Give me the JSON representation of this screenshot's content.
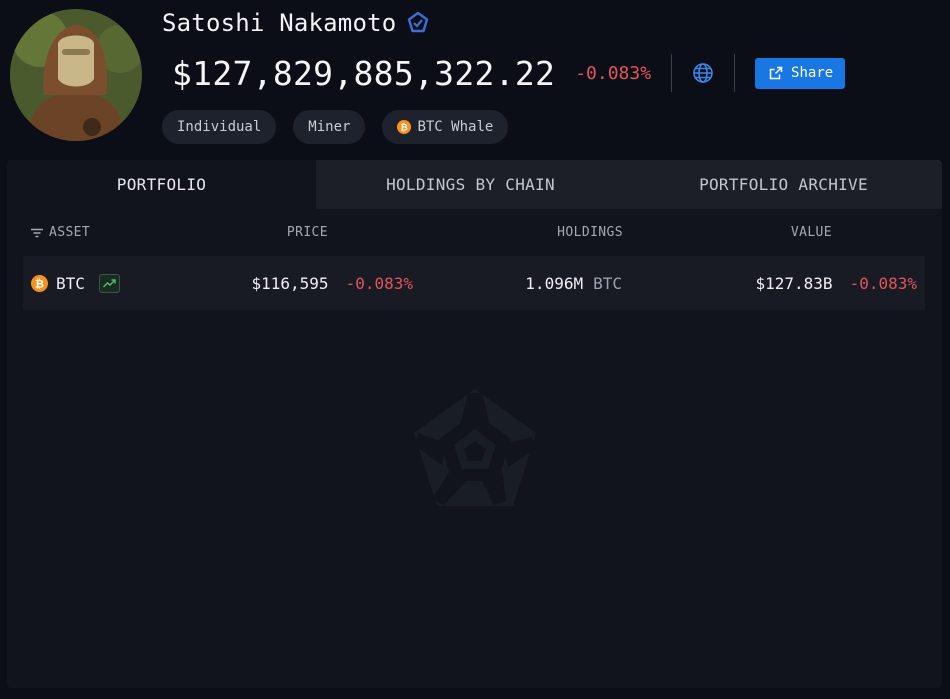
{
  "profile": {
    "name": "Satoshi Nakamoto",
    "verified_icon": "verified-badge-icon",
    "avatar_icon": "avatar-statue-image",
    "total_value": "$127,829,885,322.22",
    "total_change": "-0.083%",
    "share_label": "Share",
    "tags": [
      {
        "label": "Individual"
      },
      {
        "label": "Miner"
      },
      {
        "label": "BTC Whale",
        "icon": "bitcoin-coin-icon"
      }
    ]
  },
  "tabs": [
    {
      "label": "PORTFOLIO",
      "active": true
    },
    {
      "label": "HOLDINGS BY CHAIN",
      "active": false
    },
    {
      "label": "PORTFOLIO ARCHIVE",
      "active": false
    }
  ],
  "table": {
    "headers": {
      "asset": "ASSET",
      "price": "PRICE",
      "holdings": "HOLDINGS",
      "value": "VALUE"
    },
    "rows": [
      {
        "asset": "BTC",
        "price": "$116,595",
        "price_change": "-0.083%",
        "holdings": "1.096M",
        "holdings_unit": "BTC",
        "value": "$127.83B",
        "value_change": "-0.083%"
      }
    ]
  },
  "colors": {
    "background": "#0b0e16",
    "panel": "#11141c",
    "accent": "#1977e3",
    "negative": "#e0555b",
    "bitcoin": "#f7931a"
  }
}
